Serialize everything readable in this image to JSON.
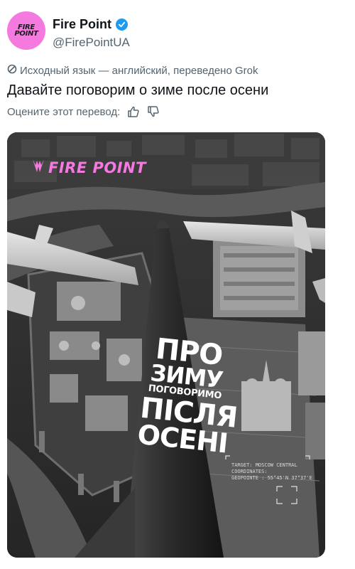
{
  "author": {
    "avatar_text": "FIRE POINT",
    "display_name": "Fire Point",
    "handle": "@FirePointUA",
    "verified_icon": "verified-badge-icon"
  },
  "translation": {
    "note": "Исходный язык — английский, переведено Grok",
    "icon": "translate-icon"
  },
  "tweet": {
    "text": "Давайте поговорим о зиме после осени"
  },
  "rating": {
    "label": "Оцените этот перевод:",
    "like_icon": "thumbs-up-icon",
    "dislike_icon": "thumbs-down-icon"
  },
  "media": {
    "brand": "FIRE POINT",
    "missile_lines": [
      "ПРО",
      "ЗИМУ",
      "ПОГОВОРИМО",
      "ПІСЛЯ",
      "ОСЕНІ"
    ],
    "target_block": {
      "line1": "TARGET: MOSCOW CENTRAL",
      "line2": "COORDINATES:",
      "line3": "GEOPOINTE : 55°45'N 37°37'E"
    }
  },
  "colors": {
    "brand_pink": "#f47ae0",
    "verified_blue": "#1d9bf0",
    "muted_text": "#536471"
  }
}
